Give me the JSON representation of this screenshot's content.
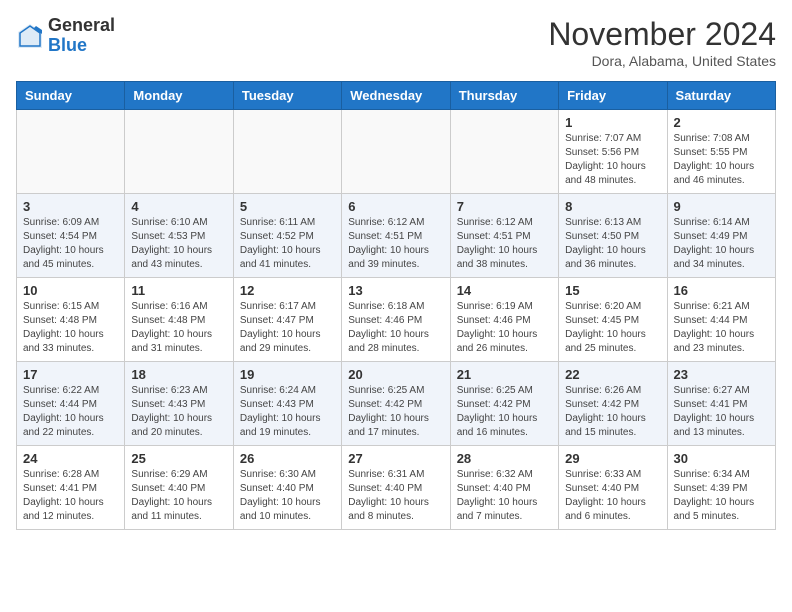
{
  "logo": {
    "general": "General",
    "blue": "Blue"
  },
  "title": "November 2024",
  "location": "Dora, Alabama, United States",
  "weekdays": [
    "Sunday",
    "Monday",
    "Tuesday",
    "Wednesday",
    "Thursday",
    "Friday",
    "Saturday"
  ],
  "weeks": [
    [
      {
        "day": "",
        "info": ""
      },
      {
        "day": "",
        "info": ""
      },
      {
        "day": "",
        "info": ""
      },
      {
        "day": "",
        "info": ""
      },
      {
        "day": "",
        "info": ""
      },
      {
        "day": "1",
        "info": "Sunrise: 7:07 AM\nSunset: 5:56 PM\nDaylight: 10 hours and 48 minutes."
      },
      {
        "day": "2",
        "info": "Sunrise: 7:08 AM\nSunset: 5:55 PM\nDaylight: 10 hours and 46 minutes."
      }
    ],
    [
      {
        "day": "3",
        "info": "Sunrise: 6:09 AM\nSunset: 4:54 PM\nDaylight: 10 hours and 45 minutes."
      },
      {
        "day": "4",
        "info": "Sunrise: 6:10 AM\nSunset: 4:53 PM\nDaylight: 10 hours and 43 minutes."
      },
      {
        "day": "5",
        "info": "Sunrise: 6:11 AM\nSunset: 4:52 PM\nDaylight: 10 hours and 41 minutes."
      },
      {
        "day": "6",
        "info": "Sunrise: 6:12 AM\nSunset: 4:51 PM\nDaylight: 10 hours and 39 minutes."
      },
      {
        "day": "7",
        "info": "Sunrise: 6:12 AM\nSunset: 4:51 PM\nDaylight: 10 hours and 38 minutes."
      },
      {
        "day": "8",
        "info": "Sunrise: 6:13 AM\nSunset: 4:50 PM\nDaylight: 10 hours and 36 minutes."
      },
      {
        "day": "9",
        "info": "Sunrise: 6:14 AM\nSunset: 4:49 PM\nDaylight: 10 hours and 34 minutes."
      }
    ],
    [
      {
        "day": "10",
        "info": "Sunrise: 6:15 AM\nSunset: 4:48 PM\nDaylight: 10 hours and 33 minutes."
      },
      {
        "day": "11",
        "info": "Sunrise: 6:16 AM\nSunset: 4:48 PM\nDaylight: 10 hours and 31 minutes."
      },
      {
        "day": "12",
        "info": "Sunrise: 6:17 AM\nSunset: 4:47 PM\nDaylight: 10 hours and 29 minutes."
      },
      {
        "day": "13",
        "info": "Sunrise: 6:18 AM\nSunset: 4:46 PM\nDaylight: 10 hours and 28 minutes."
      },
      {
        "day": "14",
        "info": "Sunrise: 6:19 AM\nSunset: 4:46 PM\nDaylight: 10 hours and 26 minutes."
      },
      {
        "day": "15",
        "info": "Sunrise: 6:20 AM\nSunset: 4:45 PM\nDaylight: 10 hours and 25 minutes."
      },
      {
        "day": "16",
        "info": "Sunrise: 6:21 AM\nSunset: 4:44 PM\nDaylight: 10 hours and 23 minutes."
      }
    ],
    [
      {
        "day": "17",
        "info": "Sunrise: 6:22 AM\nSunset: 4:44 PM\nDaylight: 10 hours and 22 minutes."
      },
      {
        "day": "18",
        "info": "Sunrise: 6:23 AM\nSunset: 4:43 PM\nDaylight: 10 hours and 20 minutes."
      },
      {
        "day": "19",
        "info": "Sunrise: 6:24 AM\nSunset: 4:43 PM\nDaylight: 10 hours and 19 minutes."
      },
      {
        "day": "20",
        "info": "Sunrise: 6:25 AM\nSunset: 4:42 PM\nDaylight: 10 hours and 17 minutes."
      },
      {
        "day": "21",
        "info": "Sunrise: 6:25 AM\nSunset: 4:42 PM\nDaylight: 10 hours and 16 minutes."
      },
      {
        "day": "22",
        "info": "Sunrise: 6:26 AM\nSunset: 4:42 PM\nDaylight: 10 hours and 15 minutes."
      },
      {
        "day": "23",
        "info": "Sunrise: 6:27 AM\nSunset: 4:41 PM\nDaylight: 10 hours and 13 minutes."
      }
    ],
    [
      {
        "day": "24",
        "info": "Sunrise: 6:28 AM\nSunset: 4:41 PM\nDaylight: 10 hours and 12 minutes."
      },
      {
        "day": "25",
        "info": "Sunrise: 6:29 AM\nSunset: 4:40 PM\nDaylight: 10 hours and 11 minutes."
      },
      {
        "day": "26",
        "info": "Sunrise: 6:30 AM\nSunset: 4:40 PM\nDaylight: 10 hours and 10 minutes."
      },
      {
        "day": "27",
        "info": "Sunrise: 6:31 AM\nSunset: 4:40 PM\nDaylight: 10 hours and 8 minutes."
      },
      {
        "day": "28",
        "info": "Sunrise: 6:32 AM\nSunset: 4:40 PM\nDaylight: 10 hours and 7 minutes."
      },
      {
        "day": "29",
        "info": "Sunrise: 6:33 AM\nSunset: 4:40 PM\nDaylight: 10 hours and 6 minutes."
      },
      {
        "day": "30",
        "info": "Sunrise: 6:34 AM\nSunset: 4:39 PM\nDaylight: 10 hours and 5 minutes."
      }
    ]
  ]
}
